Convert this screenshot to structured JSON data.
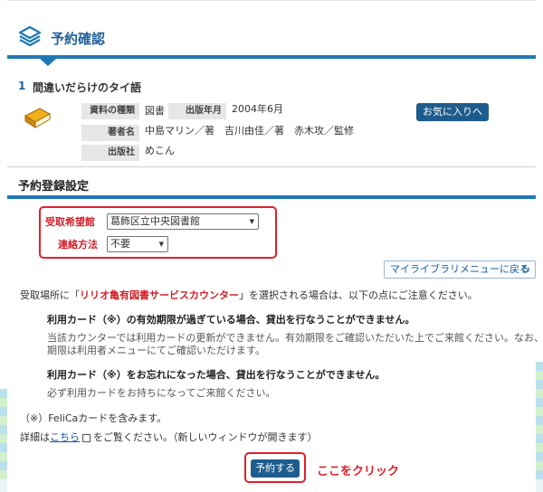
{
  "header": {
    "title": "予約確認"
  },
  "book": {
    "number": "1",
    "title": "間違いだらけのタイ語",
    "type_label": "資料の種類",
    "type_value": "図書",
    "year_label": "出版年月",
    "year_value": "2004年6月",
    "author_label": "著者名",
    "author_value": "中島マリン／著　吉川由佳／著　赤木攻／監修",
    "publisher_label": "出版社",
    "publisher_value": "めこん",
    "favorite_button": "お気に入りへ"
  },
  "settings": {
    "title": "予約登録設定",
    "pickup_label": "受取希望館",
    "pickup_value": "葛飾区立中央図書館",
    "contact_label": "連絡方法",
    "contact_value": "不要"
  },
  "mylibrary_button": "マイライブラリメニューに戻る",
  "notice": {
    "intro_before": "受取場所に「",
    "intro_highlight": "リリオ亀有図書サービスカウンター",
    "intro_after": "」を選択される場合は、以下の点にご注意ください。",
    "item1_title": "利用カード（※）の有効期限が過ぎている場合、貸出を行なうことができません。",
    "item1_body1": "当該カウンターでは利用カードの更新ができません。有効期限をご確認いただいた上でご来館ください。なお、有効",
    "item1_body2": "期限は利用者メニューにてご確認いただけます。",
    "item2_title": "利用カード（※）をお忘れになった場合、貸出を行なうことができません。",
    "item2_body": "必ず利用カードをお持ちになってご来館ください。",
    "footnote": "（※）FeliCaカードを含みます。",
    "detail_before": "詳細は",
    "detail_link": "こちら",
    "detail_after": "をご覧ください。（新しいウィンドウが開きます）"
  },
  "reserve_button": "予約する",
  "click_annotation": "ここをクリック",
  "colors": {
    "accent": "#1f78b4",
    "button": "#1d5c8c",
    "highlight": "#e0202a"
  }
}
